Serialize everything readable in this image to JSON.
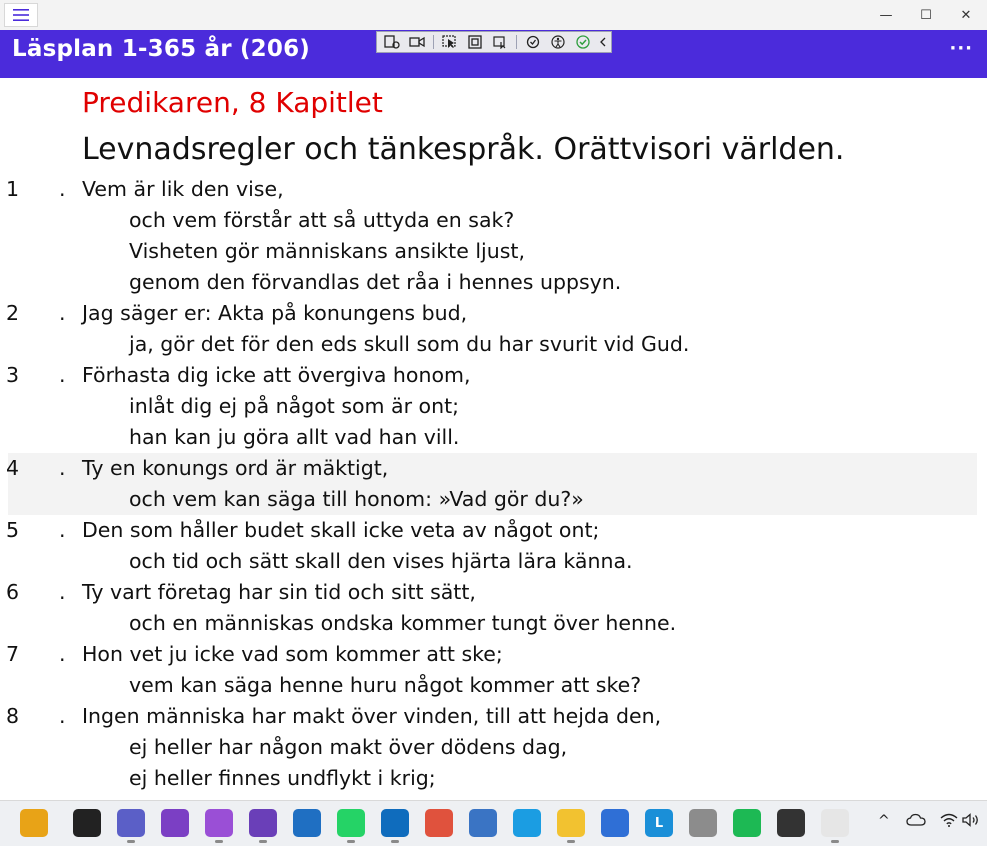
{
  "window": {
    "minimize_label": "—",
    "maximize_label": "☐",
    "close_label": "✕"
  },
  "header": {
    "title": "Läsplan 1-365 år (206)",
    "more_label": "···"
  },
  "content": {
    "chapter_heading": "Predikaren, 8 Kapitlet",
    "chapter_subtitle": "Levnadsregler och tänkespråk. Orättvisori världen.",
    "verses": [
      {
        "num": "1",
        "dot": ".",
        "lines": [
          "Vem är lik den vise,",
          "och vem förstår att så uttyda en sak?",
          "Visheten gör människans ansikte ljust,",
          "genom den förvandlas det råa i hennes uppsyn."
        ]
      },
      {
        "num": "2",
        "dot": ".",
        "lines": [
          "Jag säger er: Akta på konungens bud,",
          "ja, gör det för den eds skull som du har svurit vid Gud."
        ]
      },
      {
        "num": "3",
        "dot": ".",
        "lines": [
          "Förhasta dig icke att övergiva honom,",
          "inlåt dig ej på något som är ont;",
          "han kan ju göra allt vad han vill."
        ]
      },
      {
        "num": "4",
        "dot": ".",
        "lines": [
          "Ty en konungs ord är mäktigt,",
          "och vem kan säga till honom: »Vad gör du?»"
        ]
      },
      {
        "num": "5",
        "dot": ".",
        "lines": [
          "Den som håller budet skall icke veta av något ont;",
          "och tid och sätt skall den vises hjärta lära känna."
        ]
      },
      {
        "num": "6",
        "dot": ".",
        "lines": [
          "Ty vart företag har sin tid och sitt sätt,",
          "och en människas ondska kommer tungt över henne."
        ]
      },
      {
        "num": "7",
        "dot": ".",
        "lines": [
          "Hon vet ju icke vad som kommer att ske;",
          "vem kan säga henne huru något kommer att ske?"
        ]
      },
      {
        "num": "8",
        "dot": ".",
        "lines": [
          "Ingen människa har makt över vinden, till att hejda den,",
          "ej heller har någon makt över dödens dag,",
          "ej heller finnes undflykt i krig;"
        ]
      }
    ],
    "highlighted_verse": "4"
  },
  "taskbar": {
    "icons": [
      {
        "name": "briefcase-app-icon",
        "label": "",
        "color": "#e8a317"
      },
      {
        "name": "terminal-black-icon",
        "label": "",
        "color": "#222222"
      },
      {
        "name": "chat-app-icon",
        "label": "",
        "color": "#5b5fc7"
      },
      {
        "name": "visual-studio-icon",
        "label": "",
        "color": "#7b3fc4"
      },
      {
        "name": "visual-studio-preview-icon",
        "label": "",
        "color": "#9a4fd6"
      },
      {
        "name": "visual-studio-code-icon",
        "label": "",
        "color": "#6a3fb8"
      },
      {
        "name": "red-square-app-icon",
        "label": "",
        "color": "#1f6fc2"
      },
      {
        "name": "whatsapp-icon",
        "label": "",
        "color": "#25d366"
      },
      {
        "name": "outlook-icon",
        "label": "",
        "color": "#0f6cbd"
      },
      {
        "name": "eraser-app-icon",
        "label": "",
        "color": "#e0523d"
      },
      {
        "name": "notepad-icon",
        "label": "",
        "color": "#3a74c4"
      },
      {
        "name": "edge-browser-icon",
        "label": "",
        "color": "#1b9de2"
      },
      {
        "name": "file-explorer-icon",
        "label": "",
        "color": "#f2c230"
      },
      {
        "name": "microsoft-store-icon",
        "label": "",
        "color": "#2f6fd6"
      },
      {
        "name": "letter-l-app-icon",
        "label": "L",
        "color": "#1a8fd8"
      },
      {
        "name": "database-icon",
        "label": "",
        "color": "#8c8c8c"
      },
      {
        "name": "spotify-icon",
        "label": "",
        "color": "#1db954"
      },
      {
        "name": "command-prompt-icon",
        "label": "",
        "color": "#333333"
      },
      {
        "name": "reading-plan-app-icon",
        "label": "",
        "color": "#e6e6e6"
      }
    ],
    "tray": {
      "chevron_label": "^"
    }
  }
}
